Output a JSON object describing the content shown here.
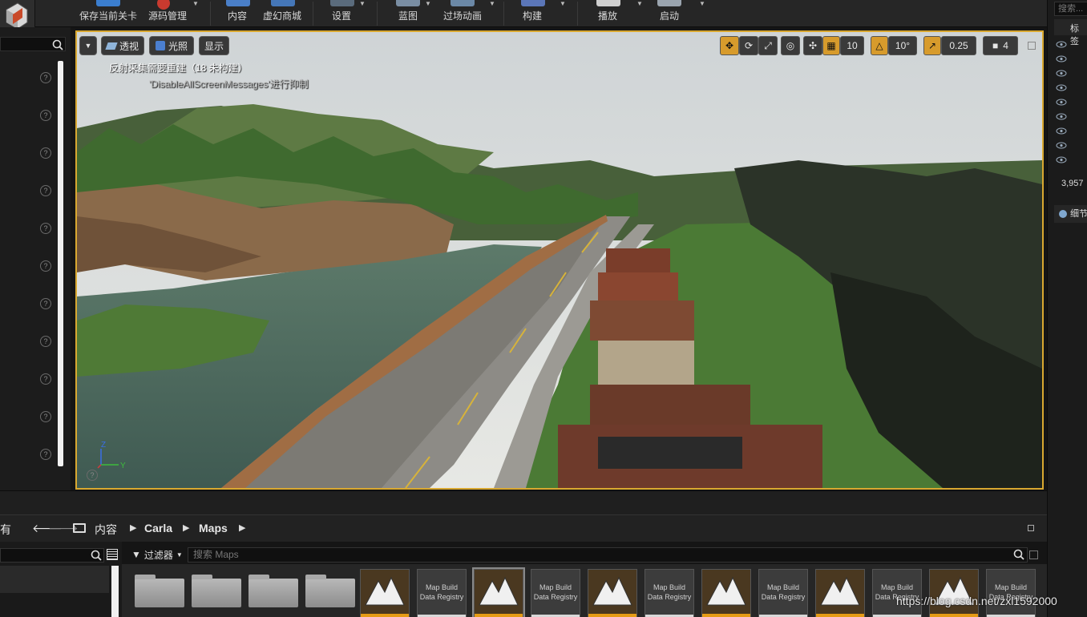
{
  "toolbar": {
    "items": [
      {
        "label": "保存当前关卡"
      },
      {
        "label": "源码管理"
      },
      {
        "label": "内容"
      },
      {
        "label": "虚幻商城"
      },
      {
        "label": "设置"
      },
      {
        "label": "蓝图"
      },
      {
        "label": "过场动画"
      },
      {
        "label": "构建"
      },
      {
        "label": "播放"
      },
      {
        "label": "启动"
      }
    ]
  },
  "viewport": {
    "buttons": {
      "perspective": "透视",
      "lit": "光照",
      "show": "显示"
    },
    "messages": {
      "line1": "反射采集需要重建（18 未构建）",
      "line2": "'DisableAllScreenMessages'进行抑制"
    },
    "tools": {
      "grid_snap": "10",
      "rotation_snap": "10°",
      "scale_snap": "0.25",
      "camera_speed": "4"
    },
    "axis": {
      "z": "Z",
      "y": "Y"
    }
  },
  "outliner": {
    "search_placeholder": "搜索...",
    "column_label": "标签",
    "count": "3,957",
    "details_tab": "细节"
  },
  "content_browser": {
    "left_label": "有",
    "breadcrumb": [
      "内容",
      "Carla",
      "Maps"
    ],
    "filter_label": "过滤器",
    "search_placeholder": "搜索 Maps",
    "assets": [
      {
        "label": "Map Build Data Registry"
      }
    ]
  },
  "watermark": "https://blog.csdn.net/zxl1592000",
  "colors": {
    "accent": "#d9a830",
    "map_bar": "#e59b15"
  }
}
